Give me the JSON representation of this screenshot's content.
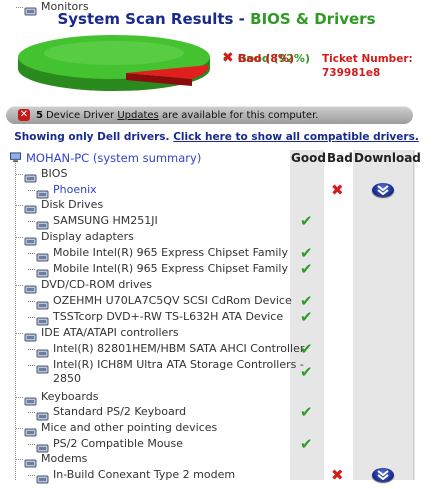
{
  "title": {
    "main": "System Scan Results - ",
    "accent": "BIOS & Drivers"
  },
  "legend": {
    "good": "Good (92%)",
    "bad": "Bad (8%)"
  },
  "scan_chart": {
    "good_percent": 92,
    "bad_percent": 8
  },
  "ticket": {
    "label": "Ticket Number:",
    "value": "739981e8"
  },
  "banner": {
    "count": "5",
    "text_pre": "Device Driver",
    "link": "Updates",
    "text_post": "are available for this computer."
  },
  "filter": {
    "text": "Showing only Dell drivers.",
    "link": "Click here to show all compatible drivers."
  },
  "columns": {
    "good": "Good",
    "bad": "Bad",
    "download": "Download"
  },
  "root": {
    "label": "MOHAN-PC (system summary)"
  },
  "rows": [
    {
      "label": "BIOS",
      "level": 1,
      "status": ""
    },
    {
      "label": "Phoenix",
      "level": 2,
      "status": "bad",
      "link": true
    },
    {
      "label": "Disk Drives",
      "level": 1,
      "status": ""
    },
    {
      "label": "SAMSUNG HM251JI",
      "level": 2,
      "status": "good"
    },
    {
      "label": "Display adapters",
      "level": 1,
      "status": ""
    },
    {
      "label": "Mobile Intel(R) 965 Express Chipset Family",
      "level": 2,
      "status": "good"
    },
    {
      "label": "Mobile Intel(R) 965 Express Chipset Family",
      "level": 2,
      "status": "good"
    },
    {
      "label": "DVD/CD-ROM drives",
      "level": 1,
      "status": ""
    },
    {
      "label": "OZEHMH U70LA7C5QV SCSI CdRom Device",
      "level": 2,
      "status": "good"
    },
    {
      "label": "TSSTcorp DVD+-RW TS-L632H ATA Device",
      "level": 2,
      "status": "good"
    },
    {
      "label": "IDE ATA/ATAPI controllers",
      "level": 1,
      "status": ""
    },
    {
      "label": "Intel(R) 82801HEM/HBM SATA AHCI Controller",
      "level": 2,
      "status": "good"
    },
    {
      "label": "Intel(R) ICH8M Ultra ATA Storage Controllers -",
      "label2": "2850",
      "level": 2,
      "status": "good"
    },
    {
      "label": "Keyboards",
      "level": 1,
      "status": ""
    },
    {
      "label": "Standard PS/2 Keyboard",
      "level": 2,
      "status": "good"
    },
    {
      "label": "Mice and other pointing devices",
      "level": 1,
      "status": ""
    },
    {
      "label": "PS/2 Compatible Mouse",
      "level": 2,
      "status": "good"
    },
    {
      "label": "Modems",
      "level": 1,
      "status": ""
    },
    {
      "label": "In-Build Conexant Type 2 modem",
      "level": 2,
      "status": "bad"
    },
    {
      "label": "Monitors",
      "level": 1,
      "status": ""
    }
  ],
  "icons": {
    "good": "check-icon",
    "bad": "x-icon",
    "download": "download-chevron-icon"
  },
  "colors": {
    "good": "#2f9a24",
    "bad": "#d21c1c",
    "title": "#1a2a8c"
  }
}
